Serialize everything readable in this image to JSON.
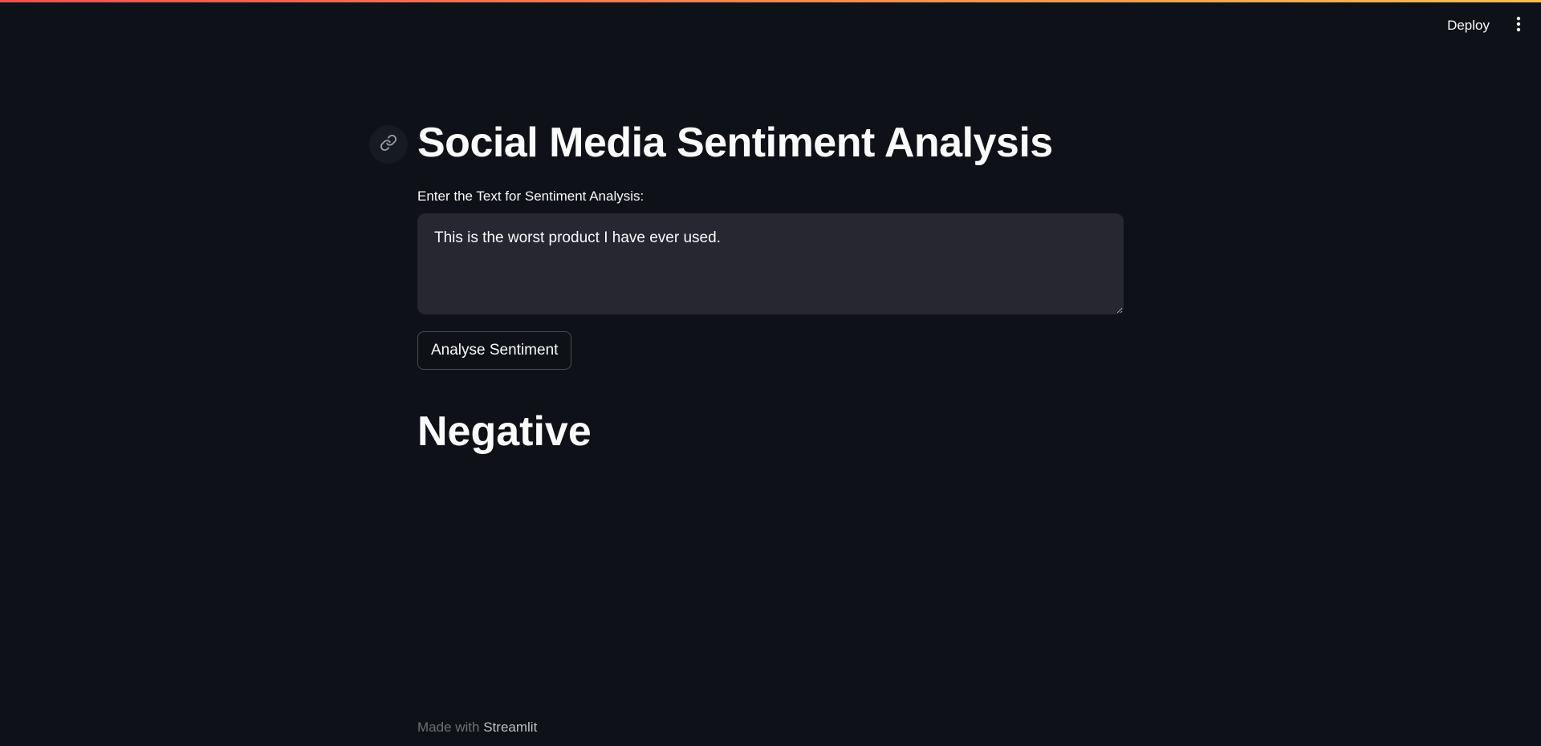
{
  "header": {
    "deploy_label": "Deploy",
    "menu_icon": "kebab-menu-icon"
  },
  "main": {
    "title": "Social Media Sentiment Analysis",
    "anchor_icon": "link-icon",
    "input_label": "Enter the Text for Sentiment Analysis:",
    "input_value": "This is the worst product I have ever used.",
    "button_label": "Analyse Sentiment",
    "result": "Negative"
  },
  "footer": {
    "prefix": "Made with",
    "brand": "Streamlit"
  },
  "colors": {
    "background": "#0e1117",
    "text": "#fafafa",
    "input_bg": "#262730",
    "decoration_start": "#ff4b4b",
    "decoration_end": "#ffbd45"
  }
}
